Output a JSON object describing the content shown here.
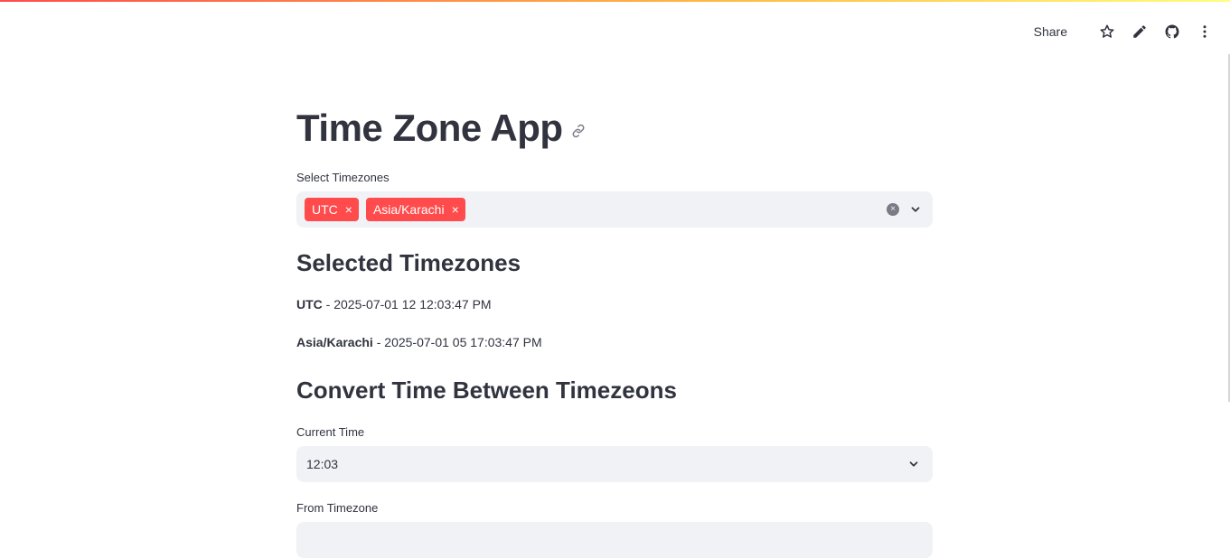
{
  "toolbar": {
    "share_label": "Share",
    "icons": [
      "star-icon",
      "pencil-icon",
      "github-icon",
      "more-vertical-icon"
    ]
  },
  "page": {
    "title": "Time Zone App"
  },
  "timezone_select": {
    "label": "Select Timezones",
    "selected": [
      "UTC",
      "Asia/Karachi"
    ],
    "remove_glyph": "×",
    "clear_glyph": "×"
  },
  "selected_section": {
    "heading": "Selected Timezones",
    "entries": [
      {
        "zone": "UTC",
        "separator": " - ",
        "time": "2025-07-01 12 12:03:47 PM"
      },
      {
        "zone": "Asia/Karachi",
        "separator": " - ",
        "time": "2025-07-01 05 17:03:47 PM"
      }
    ]
  },
  "convert_section": {
    "heading": "Convert Time Between Timezeons",
    "current_time_label": "Current Time",
    "current_time_value": "12:03",
    "from_timezone_label": "From Timezone"
  },
  "colors": {
    "accent": "#ff4b4b",
    "text": "#31333f",
    "input_bg": "#f0f2f6"
  }
}
